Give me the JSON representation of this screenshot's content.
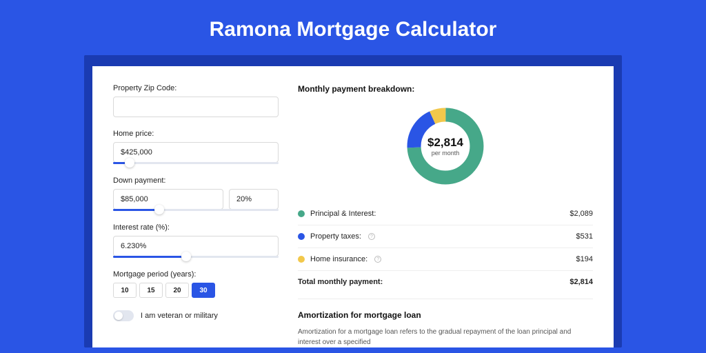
{
  "title": "Ramona Mortgage Calculator",
  "form": {
    "zip": {
      "label": "Property Zip Code:",
      "value": ""
    },
    "home_price": {
      "label": "Home price:",
      "value": "$425,000",
      "slider_pct": 10
    },
    "down_payment": {
      "label": "Down payment:",
      "amount": "$85,000",
      "percent": "20%",
      "slider_pct": 28
    },
    "interest_rate": {
      "label": "Interest rate (%):",
      "value": "6.230%",
      "slider_pct": 44
    },
    "period": {
      "label": "Mortgage period (years):",
      "options": [
        "10",
        "15",
        "20",
        "30"
      ],
      "active_index": 3
    },
    "veteran": {
      "label": "I am veteran or military",
      "checked": false
    }
  },
  "breakdown": {
    "title": "Monthly payment breakdown:",
    "center_amount": "$2,814",
    "center_sub": "per month",
    "items": [
      {
        "name": "Principal & Interest:",
        "value": "$2,089",
        "color": "#46a889",
        "info": false
      },
      {
        "name": "Property taxes:",
        "value": "$531",
        "color": "#2a55e5",
        "info": true
      },
      {
        "name": "Home insurance:",
        "value": "$194",
        "color": "#f2c84b",
        "info": true
      }
    ],
    "total": {
      "name": "Total monthly payment:",
      "value": "$2,814"
    }
  },
  "chart_data": {
    "type": "pie",
    "title": "Monthly payment breakdown",
    "series": [
      {
        "name": "Principal & Interest",
        "value": 2089,
        "color": "#46a889"
      },
      {
        "name": "Property taxes",
        "value": 531,
        "color": "#2a55e5"
      },
      {
        "name": "Home insurance",
        "value": 194,
        "color": "#f2c84b"
      }
    ],
    "total": 2814
  },
  "amortization": {
    "title": "Amortization for mortgage loan",
    "text": "Amortization for a mortgage loan refers to the gradual repayment of the loan principal and interest over a specified"
  }
}
